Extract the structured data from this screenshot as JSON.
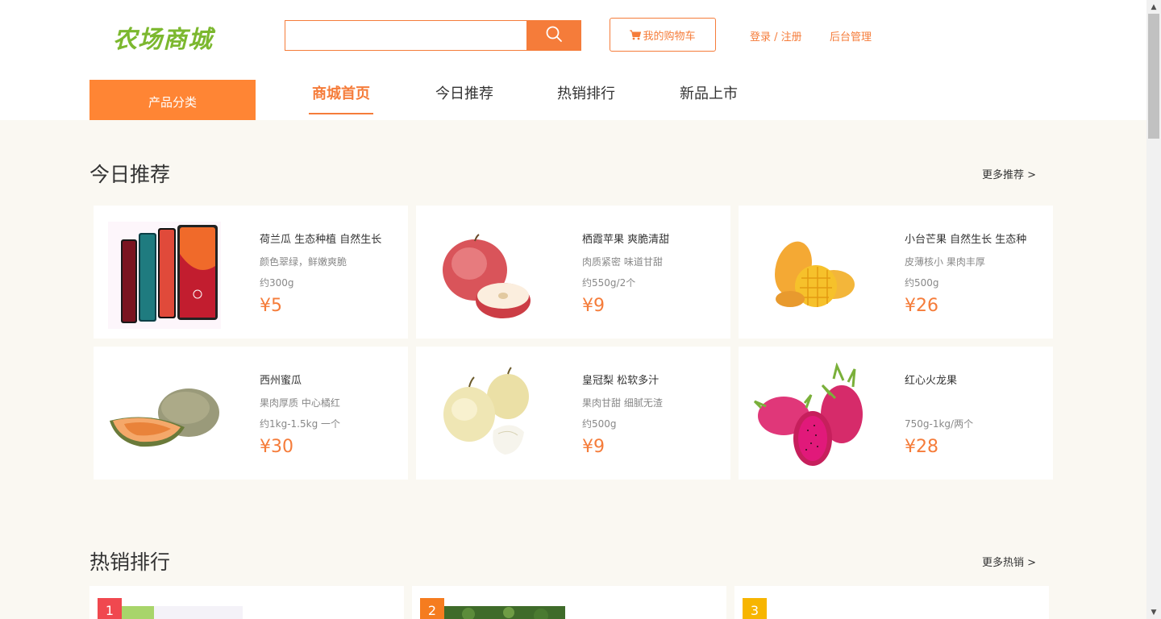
{
  "header": {
    "logo_text": "农场商城",
    "search": {
      "value": "",
      "placeholder": ""
    },
    "cart_label": "我的购物车",
    "login_label": "登录 / 注册",
    "admin_label": "后台管理",
    "category_label": "产品分类",
    "nav": [
      {
        "label": "商城首页",
        "active": true
      },
      {
        "label": "今日推荐",
        "active": false
      },
      {
        "label": "热销排行",
        "active": false
      },
      {
        "label": "新品上市",
        "active": false
      }
    ]
  },
  "recommend": {
    "title": "今日推荐",
    "more_label": "更多推荐 >",
    "products": [
      {
        "name": "荷兰瓜 生态种植 自然生长",
        "desc": "颜色翠绿，鲜嫩爽脆",
        "weight": "约300g",
        "price": "¥5",
        "image": "phone-image"
      },
      {
        "name": "栖霞苹果 爽脆清甜",
        "desc": "肉质紧密 味道甘甜",
        "weight": "约550g/2个",
        "price": "¥9",
        "image": "apple-image"
      },
      {
        "name": "小台芒果 自然生长 生态种",
        "desc": "皮薄核小 果肉丰厚",
        "weight": "约500g",
        "price": "¥26",
        "image": "mango-image"
      },
      {
        "name": "西州蜜瓜",
        "desc": "果肉厚质 中心橘红",
        "weight": "约1kg-1.5kg 一个",
        "price": "¥30",
        "image": "melon-image"
      },
      {
        "name": "皇冠梨 松软多汁",
        "desc": "果肉甘甜 细腻无渣",
        "weight": "约500g",
        "price": "¥9",
        "image": "pear-image"
      },
      {
        "name": "红心火龙果",
        "desc": "",
        "weight": "750g-1kg/两个",
        "price": "¥28",
        "image": "dragonfruit-image"
      }
    ]
  },
  "hot": {
    "title": "热销排行",
    "more_label": "更多热销 >",
    "ranks": [
      {
        "rank": "1",
        "color": "#f0484f"
      },
      {
        "rank": "2",
        "color": "#f57c1f"
      },
      {
        "rank": "3",
        "color": "#f7b500"
      }
    ]
  },
  "colors": {
    "accent": "#f57c3a",
    "logo": "#7cb82f",
    "background": "#faf8f2"
  }
}
